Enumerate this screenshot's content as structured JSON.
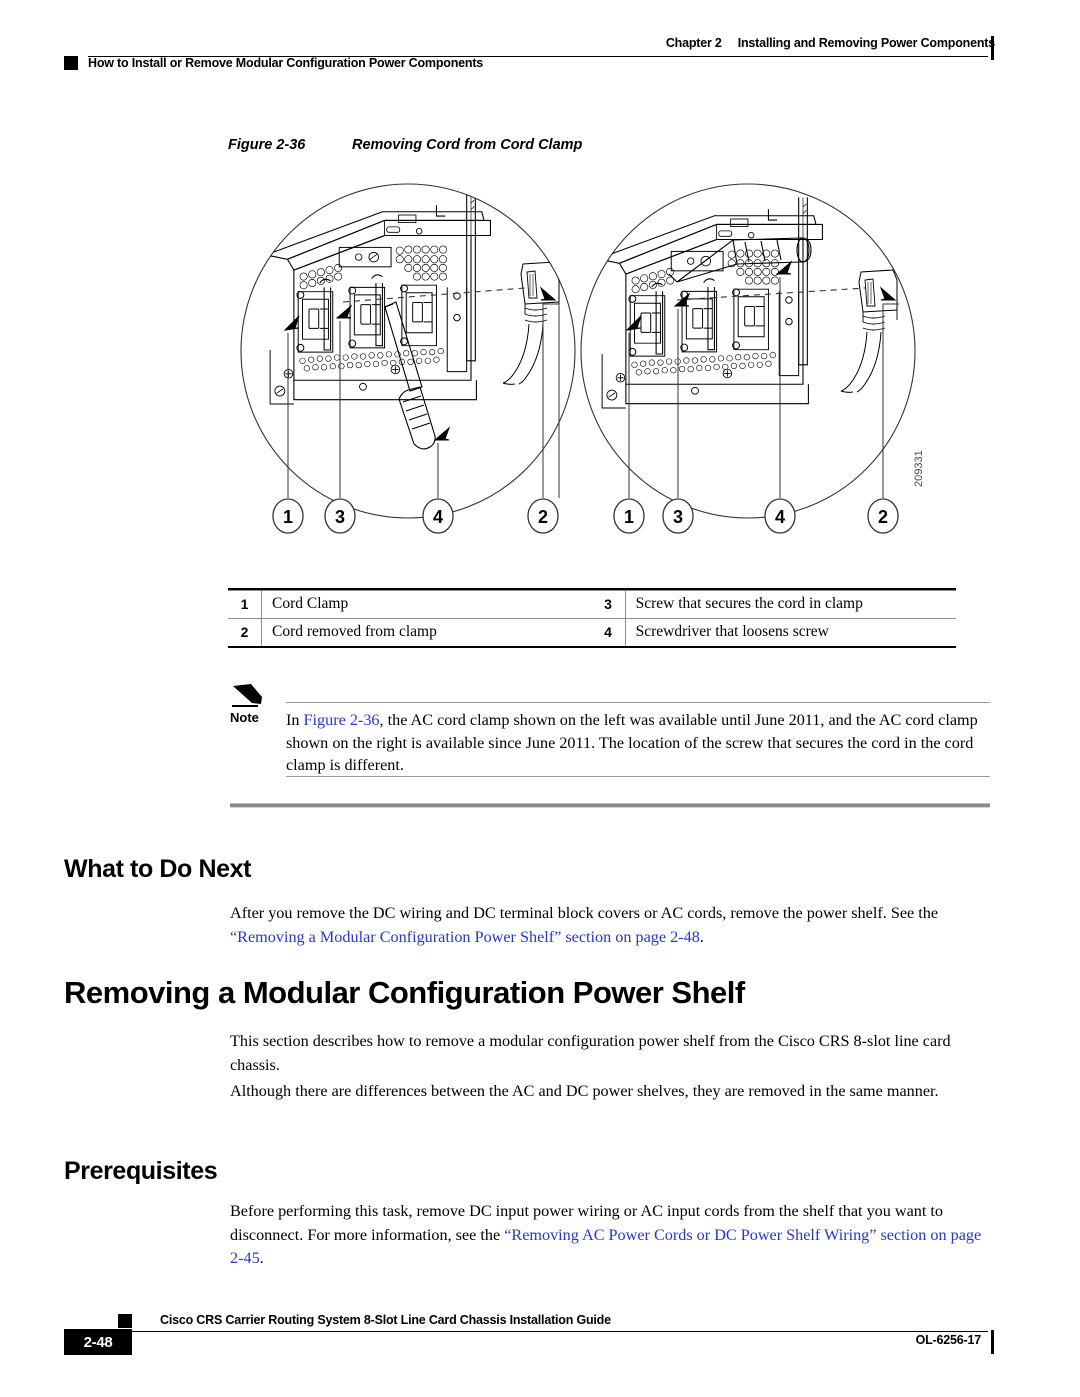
{
  "header": {
    "chapter": "Chapter 2",
    "chapter_title": "Installing and Removing Power Components",
    "section_title": "How to Install or Remove Modular Configuration Power Components"
  },
  "figure": {
    "label": "Figure 2-36",
    "title": "Removing Cord from Cord Clamp",
    "art_id": "209331",
    "callouts_left": [
      "1",
      "3",
      "4",
      "2"
    ],
    "callouts_right": [
      "1",
      "3",
      "4",
      "2"
    ],
    "legend": [
      {
        "num": "1",
        "text": "Cord Clamp",
        "num2": "3",
        "text2": "Screw that secures the cord in clamp"
      },
      {
        "num": "2",
        "text": "Cord removed from clamp",
        "num2": "4",
        "text2": "Screwdriver that loosens screw"
      }
    ]
  },
  "note": {
    "label": "Note",
    "prefix": "In ",
    "link": "Figure 2-36",
    "body": ", the AC cord clamp shown on the left was available until June 2011, and the AC cord clamp shown on the right is available since June 2011. The location of the screw that secures the cord in the cord clamp is different."
  },
  "what_to_do_next": {
    "heading": "What to Do Next",
    "para_prefix": "After you remove the DC wiring and DC terminal block covers or AC cords, remove the power shelf. See the ",
    "para_link": "“Removing a Modular Configuration Power Shelf” section on page 2-48",
    "para_suffix": "."
  },
  "main_section": {
    "heading": "Removing a Modular Configuration Power Shelf",
    "para1": "This section describes how to remove a modular configuration power shelf from the Cisco CRS 8-slot line card chassis.",
    "para2": "Although there are differences between the AC and DC power shelves, they are removed in the same manner."
  },
  "prerequisites": {
    "heading": "Prerequisites",
    "para_prefix": "Before performing this task, remove DC input power wiring or AC input cords from the shelf that you want to disconnect. For more information, see the ",
    "para_link": "“Removing AC Power Cords or DC Power Shelf Wiring” section on page 2-45",
    "para_suffix": "."
  },
  "footer": {
    "title": "Cisco CRS Carrier Routing System 8-Slot Line Card Chassis Installation Guide",
    "page_number": "2-48",
    "doc_id": "OL-6256-17"
  },
  "colors": {
    "link": "#2737c8",
    "rule": "#000000",
    "gray_rule": "#9a9a9a"
  }
}
